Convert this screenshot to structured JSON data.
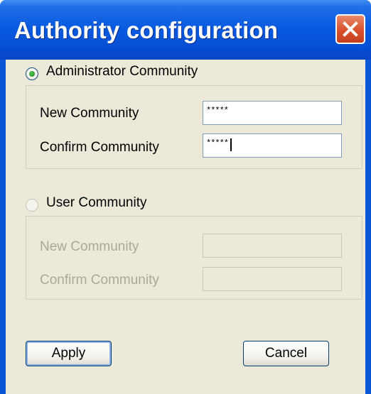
{
  "window": {
    "title": "Authority configuration",
    "close_icon": "close-icon"
  },
  "admin": {
    "radio_label": "Administrator Community",
    "selected": true,
    "new_label": "New Community",
    "new_value": "*****",
    "confirm_label": "Confirm Community",
    "confirm_value": "*****"
  },
  "user": {
    "radio_label": "User Community",
    "selected": false,
    "new_label": "New Community",
    "new_value": "",
    "confirm_label": "Confirm Community",
    "confirm_value": ""
  },
  "buttons": {
    "apply": "Apply",
    "cancel": "Cancel"
  },
  "colors": {
    "titlebar": "#0a5be0",
    "client": "#ece9d8",
    "close": "#d9512c"
  }
}
